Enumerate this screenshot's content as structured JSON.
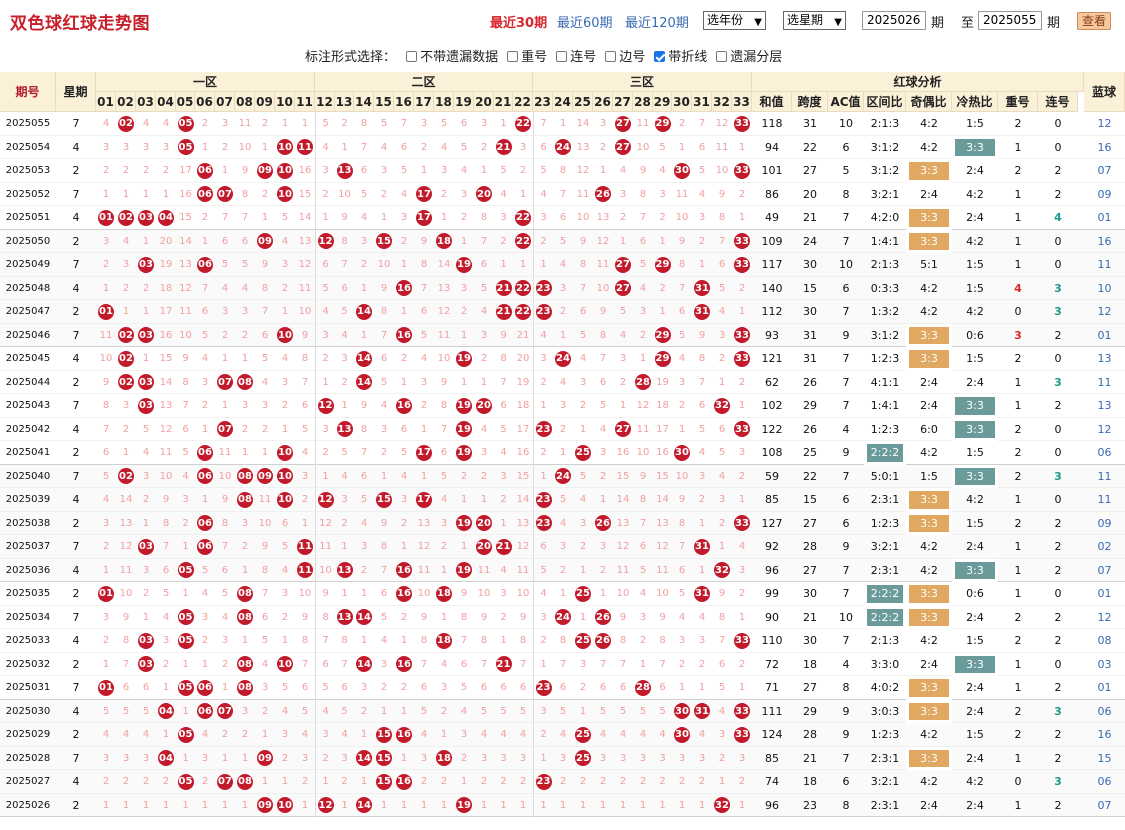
{
  "header": {
    "title": "双色球红球走势图",
    "periods": [
      "最近30期",
      "最近60期",
      "最近120期"
    ],
    "active_period": 0,
    "year_select": "选年份",
    "week_select": "选星期",
    "from_value": "2025026",
    "from_unit": "期",
    "to_label": "至",
    "to_value": "2025055",
    "to_unit": "期",
    "view_button": "查看"
  },
  "options": {
    "label": "标注形式选择：",
    "items": [
      {
        "label": "不带遗漏数据",
        "checked": false
      },
      {
        "label": "重号",
        "checked": false
      },
      {
        "label": "连号",
        "checked": false
      },
      {
        "label": "边号",
        "checked": false
      },
      {
        "label": "带折线",
        "checked": true
      },
      {
        "label": "遗漏分层",
        "checked": false
      }
    ]
  },
  "table": {
    "h_period": "期号",
    "h_week": "星期",
    "zones": [
      "一区",
      "二区",
      "三区"
    ],
    "h_analysis": "红球分析",
    "h_blue": "蓝球",
    "analysis_cols": [
      "和值",
      "跨度",
      "AC值",
      "区间比",
      "奇偶比",
      "冷热比",
      "重号",
      "连号"
    ],
    "zone_colors": {
      "ball": "#c31a2b",
      "miss_text": "#f0a0a0",
      "band_red": "#fde6e6",
      "band_blue": "#e3ecf8",
      "hl_orange": "#e0a860",
      "hl_teal": "#6a9a9a"
    },
    "rows": [
      {
        "p": "2025055",
        "w": "7",
        "r": [
          2,
          5,
          22,
          27,
          29,
          33
        ],
        "s": [
          "118",
          "31",
          "10",
          "2:1:3",
          "4:2",
          "1:5",
          "2",
          "0"
        ],
        "b": "12"
      },
      {
        "p": "2025054",
        "w": "4",
        "r": [
          5,
          10,
          11,
          21,
          24,
          27
        ],
        "s": [
          "94",
          "22",
          "6",
          "3:1:2",
          "4:2",
          "3:3",
          "1",
          "0"
        ],
        "b": "16"
      },
      {
        "p": "2025053",
        "w": "2",
        "r": [
          6,
          9,
          10,
          13,
          30,
          33
        ],
        "s": [
          "101",
          "27",
          "5",
          "3:1:2",
          "3:3",
          "2:4",
          "2",
          "2"
        ],
        "b": "07"
      },
      {
        "p": "2025052",
        "w": "7",
        "r": [
          6,
          7,
          10,
          17,
          20,
          26
        ],
        "s": [
          "86",
          "20",
          "8",
          "3:2:1",
          "2:4",
          "4:2",
          "1",
          "2"
        ],
        "b": "09"
      },
      {
        "p": "2025051",
        "w": "4",
        "r": [
          1,
          2,
          3,
          4,
          17,
          22
        ],
        "s": [
          "49",
          "21",
          "7",
          "4:2:0",
          "3:3",
          "2:4",
          "1",
          "4"
        ],
        "b": "01"
      },
      {
        "p": "2025050",
        "w": "2",
        "r": [
          9,
          12,
          15,
          18,
          22,
          33
        ],
        "s": [
          "109",
          "24",
          "7",
          "1:4:1",
          "3:3",
          "4:2",
          "1",
          "0"
        ],
        "b": "16"
      },
      {
        "p": "2025049",
        "w": "7",
        "r": [
          3,
          6,
          19,
          27,
          29,
          33
        ],
        "s": [
          "117",
          "30",
          "10",
          "2:1:3",
          "5:1",
          "1:5",
          "1",
          "0"
        ],
        "b": "11"
      },
      {
        "p": "2025048",
        "w": "4",
        "r": [
          16,
          21,
          22,
          23,
          27,
          31
        ],
        "s": [
          "140",
          "15",
          "6",
          "0:3:3",
          "4:2",
          "1:5",
          "4",
          "3"
        ],
        "b": "10"
      },
      {
        "p": "2025047",
        "w": "2",
        "r": [
          1,
          14,
          21,
          22,
          23,
          31
        ],
        "s": [
          "112",
          "30",
          "7",
          "1:3:2",
          "4:2",
          "4:2",
          "0",
          "3"
        ],
        "b": "12"
      },
      {
        "p": "2025046",
        "w": "7",
        "r": [
          2,
          3,
          10,
          16,
          29,
          33
        ],
        "s": [
          "93",
          "31",
          "9",
          "3:1:2",
          "3:3",
          "0:6",
          "3",
          "2"
        ],
        "b": "01"
      },
      {
        "p": "2025045",
        "w": "4",
        "r": [
          2,
          14,
          19,
          24,
          29,
          33
        ],
        "s": [
          "121",
          "31",
          "7",
          "1:2:3",
          "3:3",
          "1:5",
          "2",
          "0"
        ],
        "b": "13"
      },
      {
        "p": "2025044",
        "w": "2",
        "r": [
          2,
          3,
          7,
          8,
          14,
          28
        ],
        "s": [
          "62",
          "26",
          "7",
          "4:1:1",
          "2:4",
          "2:4",
          "1",
          "3"
        ],
        "b": "11"
      },
      {
        "p": "2025043",
        "w": "7",
        "r": [
          3,
          12,
          16,
          19,
          20,
          32
        ],
        "s": [
          "102",
          "29",
          "7",
          "1:4:1",
          "2:4",
          "3:3",
          "1",
          "2"
        ],
        "b": "13"
      },
      {
        "p": "2025042",
        "w": "4",
        "r": [
          7,
          13,
          19,
          23,
          27,
          33
        ],
        "s": [
          "122",
          "26",
          "4",
          "1:2:3",
          "6:0",
          "3:3",
          "2",
          "0"
        ],
        "b": "12"
      },
      {
        "p": "2025041",
        "w": "2",
        "r": [
          6,
          10,
          17,
          19,
          25,
          30
        ],
        "s": [
          "108",
          "25",
          "9",
          "2:2:2",
          "4:2",
          "1:5",
          "2",
          "0"
        ],
        "b": "06"
      },
      {
        "p": "2025040",
        "w": "7",
        "r": [
          2,
          6,
          8,
          9,
          10,
          24
        ],
        "s": [
          "59",
          "22",
          "7",
          "5:0:1",
          "1:5",
          "3:3",
          "2",
          "3"
        ],
        "b": "11"
      },
      {
        "p": "2025039",
        "w": "4",
        "r": [
          8,
          10,
          12,
          15,
          17,
          23
        ],
        "s": [
          "85",
          "15",
          "6",
          "2:3:1",
          "3:3",
          "4:2",
          "1",
          "0"
        ],
        "b": "11"
      },
      {
        "p": "2025038",
        "w": "2",
        "r": [
          6,
          19,
          20,
          23,
          26,
          33
        ],
        "s": [
          "127",
          "27",
          "6",
          "1:2:3",
          "3:3",
          "1:5",
          "2",
          "2"
        ],
        "b": "09"
      },
      {
        "p": "2025037",
        "w": "7",
        "r": [
          3,
          6,
          11,
          20,
          21,
          31
        ],
        "s": [
          "92",
          "28",
          "9",
          "3:2:1",
          "4:2",
          "2:4",
          "1",
          "2"
        ],
        "b": "02"
      },
      {
        "p": "2025036",
        "w": "4",
        "r": [
          5,
          11,
          13,
          16,
          19,
          32
        ],
        "s": [
          "96",
          "27",
          "7",
          "2:3:1",
          "4:2",
          "3:3",
          "1",
          "2"
        ],
        "b": "07"
      },
      {
        "p": "2025035",
        "w": "2",
        "r": [
          1,
          8,
          16,
          18,
          25,
          31
        ],
        "s": [
          "99",
          "30",
          "7",
          "2:2:2",
          "3:3",
          "0:6",
          "1",
          "0"
        ],
        "b": "01"
      },
      {
        "p": "2025034",
        "w": "7",
        "r": [
          5,
          8,
          13,
          14,
          24,
          26
        ],
        "s": [
          "90",
          "21",
          "10",
          "2:2:2",
          "3:3",
          "2:4",
          "2",
          "2"
        ],
        "b": "12"
      },
      {
        "p": "2025033",
        "w": "4",
        "r": [
          3,
          5,
          18,
          25,
          26,
          33
        ],
        "s": [
          "110",
          "30",
          "7",
          "2:1:3",
          "4:2",
          "1:5",
          "2",
          "2"
        ],
        "b": "08"
      },
      {
        "p": "2025032",
        "w": "2",
        "r": [
          3,
          8,
          10,
          14,
          16,
          21
        ],
        "s": [
          "72",
          "18",
          "4",
          "3:3:0",
          "2:4",
          "3:3",
          "1",
          "0"
        ],
        "b": "03"
      },
      {
        "p": "2025031",
        "w": "7",
        "r": [
          1,
          5,
          6,
          8,
          23,
          28
        ],
        "s": [
          "71",
          "27",
          "8",
          "4:0:2",
          "3:3",
          "2:4",
          "1",
          "2"
        ],
        "b": "01"
      },
      {
        "p": "2025030",
        "w": "4",
        "r": [
          4,
          6,
          7,
          30,
          31,
          33
        ],
        "s": [
          "111",
          "29",
          "9",
          "3:0:3",
          "3:3",
          "2:4",
          "2",
          "3"
        ],
        "b": "06"
      },
      {
        "p": "2025029",
        "w": "2",
        "r": [
          5,
          15,
          16,
          25,
          30,
          33
        ],
        "s": [
          "124",
          "28",
          "9",
          "1:2:3",
          "4:2",
          "1:5",
          "2",
          "2"
        ],
        "b": "16"
      },
      {
        "p": "2025028",
        "w": "7",
        "r": [
          4,
          9,
          14,
          15,
          18,
          25
        ],
        "s": [
          "85",
          "21",
          "7",
          "2:3:1",
          "3:3",
          "2:4",
          "1",
          "2"
        ],
        "b": "15"
      },
      {
        "p": "2025027",
        "w": "4",
        "r": [
          5,
          7,
          8,
          15,
          16,
          23
        ],
        "s": [
          "74",
          "18",
          "6",
          "3:2:1",
          "4:2",
          "4:2",
          "0",
          "3"
        ],
        "b": "06"
      },
      {
        "p": "2025026",
        "w": "2",
        "r": [
          9,
          10,
          12,
          14,
          19,
          32
        ],
        "s": [
          "96",
          "23",
          "8",
          "2:3:1",
          "2:4",
          "2:4",
          "1",
          "2"
        ],
        "b": "07"
      }
    ]
  }
}
